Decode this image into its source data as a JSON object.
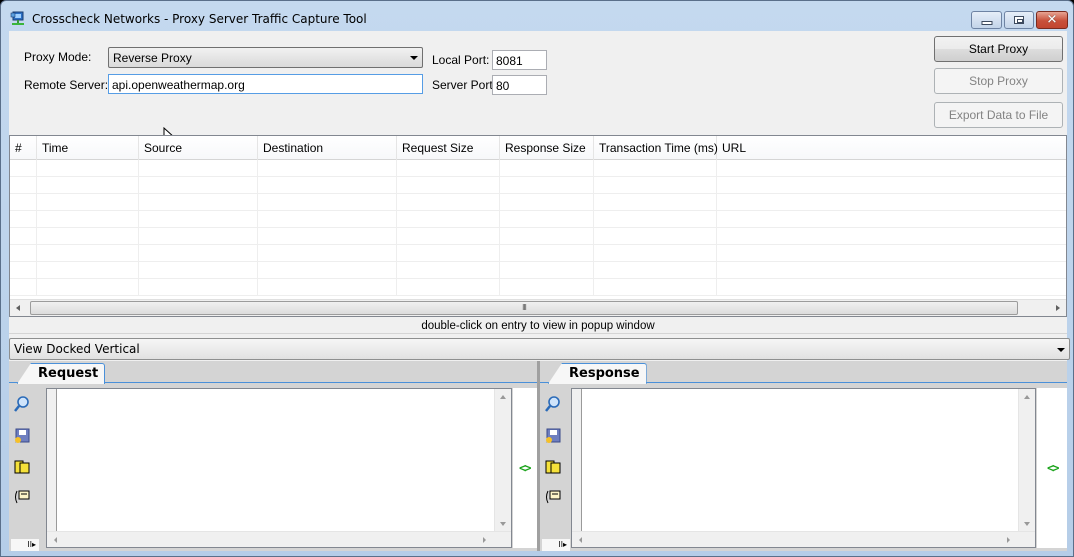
{
  "window": {
    "title": "Crosscheck Networks - Proxy Server Traffic Capture Tool",
    "controls": {
      "minimize": "minimize",
      "maximize": "maximize",
      "close": "✕"
    }
  },
  "config": {
    "proxy_mode_label": "Proxy Mode:",
    "proxy_mode_value": "Reverse Proxy",
    "remote_server_label": "Remote Server:",
    "remote_server_value": "api.openweathermap.org",
    "local_port_label": "Local Port:",
    "local_port_value": "8081",
    "server_port_label": "Server Port:",
    "server_port_value": "80"
  },
  "actions": {
    "start": "Start Proxy",
    "stop": "Stop Proxy",
    "export": "Export Data to File"
  },
  "grid": {
    "columns": [
      "#",
      "Time",
      "Source",
      "Destination",
      "Request Size",
      "Response Size",
      "Transaction Time (ms)",
      "URL"
    ],
    "rows": [],
    "scroll_grip": "III"
  },
  "hint": "double-click on entry to view in popup window",
  "view_mode": "View Docked Vertical",
  "panes": {
    "request_tab": "Request",
    "response_tab": "Response",
    "toolbar_icons": [
      "search-icon",
      "save-icon",
      "copy-icon",
      "comment-icon"
    ],
    "code_toggle": "<>",
    "expander": "II▸"
  }
}
